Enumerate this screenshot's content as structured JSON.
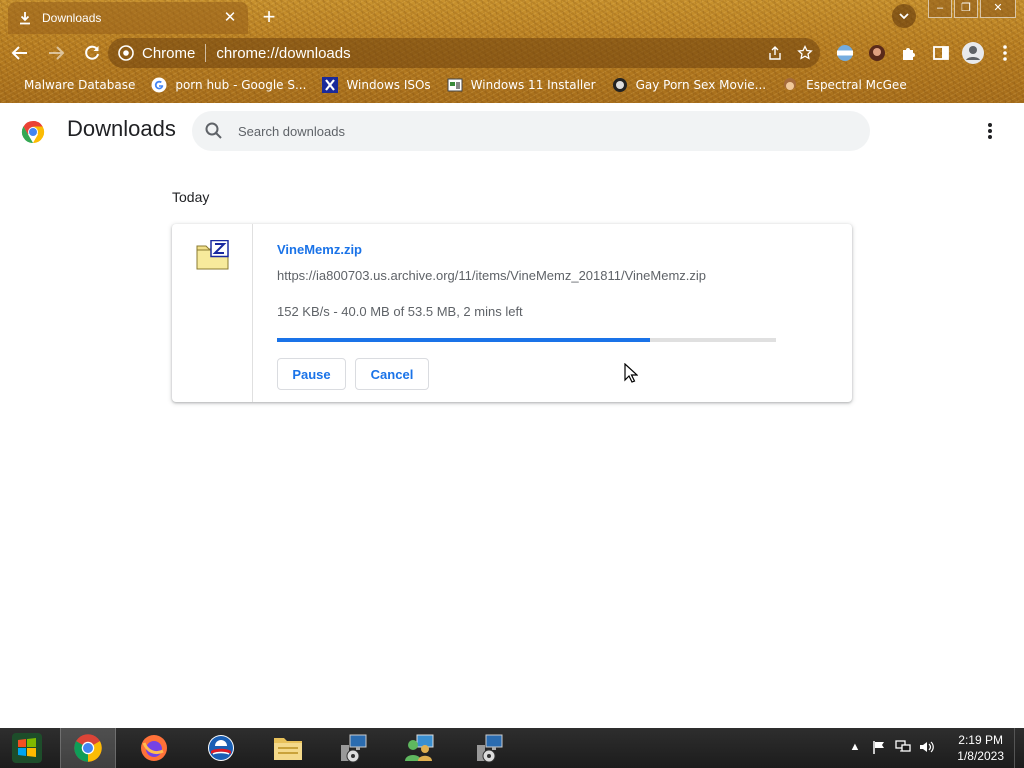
{
  "browser": {
    "tab": {
      "title": "Downloads"
    },
    "omnibox": {
      "site_label": "Chrome",
      "url": "chrome://downloads"
    },
    "bookmarks": [
      {
        "label": "Malware Database"
      },
      {
        "label": "porn hub - Google S..."
      },
      {
        "label": "Windows ISOs"
      },
      {
        "label": "Windows 11 Installer"
      },
      {
        "label": "Gay Porn Sex Movie..."
      },
      {
        "label": "Espectral McGee"
      }
    ]
  },
  "page": {
    "title": "Downloads",
    "search_placeholder": "Search downloads",
    "date_heading": "Today"
  },
  "download": {
    "file_name": "VineMemz.zip",
    "url": "https://ia800703.us.archive.org/11/items/VineMemz_201811/VineMemz.zip",
    "status": "152 KB/s - 40.0 MB of 53.5 MB, 2 mins left",
    "progress_fraction": 0.748,
    "pause_label": "Pause",
    "cancel_label": "Cancel"
  },
  "taskbar": {
    "time": "2:19 PM",
    "date": "1/8/2023"
  },
  "colors": {
    "accent": "#1a73e8",
    "theme": "#b97f22",
    "progress_track": "#e0e0e0"
  }
}
